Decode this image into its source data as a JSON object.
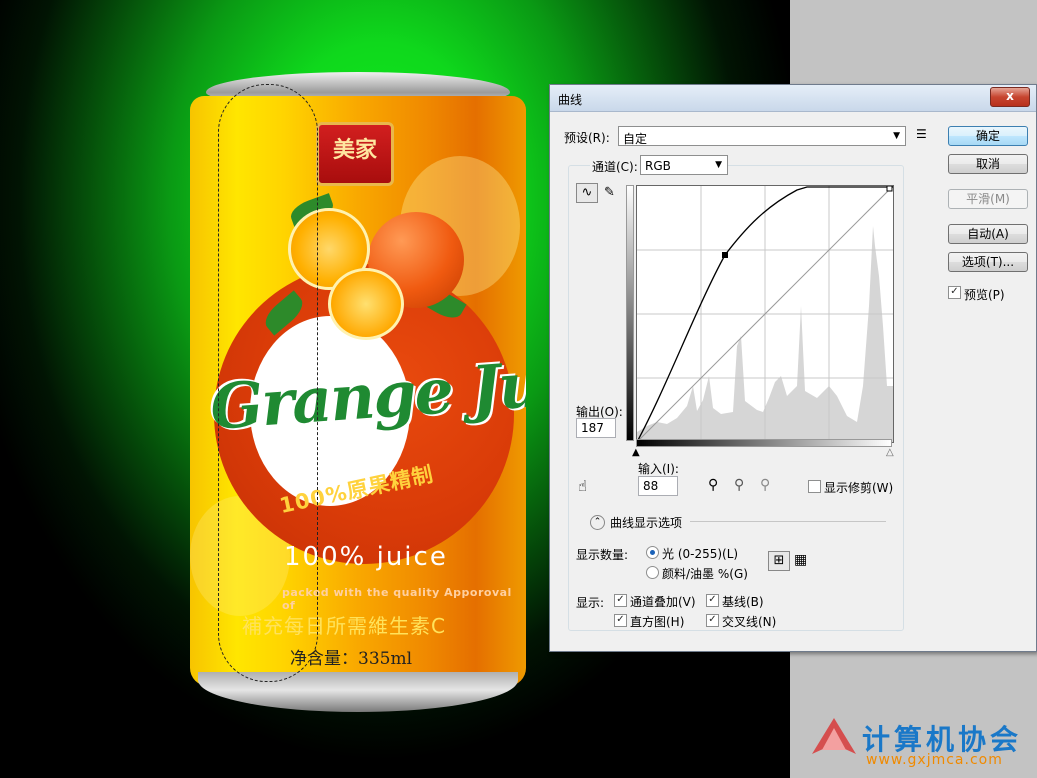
{
  "can": {
    "badge": "美家",
    "brand": "Grange Juice",
    "arc_text": "100%原果精制",
    "juice": "100% juice",
    "packed": "packed with the quality Apporoval of",
    "vitamin": "補充每日所需維生素C",
    "net": "净含量：335ml"
  },
  "dialog": {
    "title": "曲线",
    "close": "x",
    "preset_label": "预设(R):",
    "preset_value": "自定",
    "channel_label": "通道(C):",
    "channel_value": "RGB",
    "output_label": "输出(O):",
    "output_value": "187",
    "input_label": "输入(I):",
    "input_value": "88",
    "show_clipping": "显示修剪(W)",
    "curve_options": "曲线显示选项",
    "show_amount_label": "显示数量:",
    "light_option": "光 (0-255)(L)",
    "pigment_option": "颜料/油墨 %(G)",
    "show_label": "显示:",
    "channel_overlay": "通道叠加(V)",
    "baseline": "基线(B)",
    "histogram": "直方图(H)",
    "intersection": "交叉线(N)",
    "buttons": {
      "ok": "确定",
      "cancel": "取消",
      "smooth": "平滑(M)",
      "auto": "自动(A)",
      "options": "选项(T)..."
    },
    "preview": "预览(P)",
    "checks": {
      "preview": true,
      "show_clipping": false,
      "channel_overlay": true,
      "baseline": true,
      "histogram": true,
      "intersection": true
    },
    "curve_point": {
      "input": 88,
      "output": 187
    }
  },
  "watermark": {
    "title": "计算机协会",
    "url": "www.gxjmca.com"
  },
  "colors": {
    "accent": "#3c7fb1",
    "watermark_blue": "#1a78c8",
    "watermark_orange": "#f08a00"
  }
}
